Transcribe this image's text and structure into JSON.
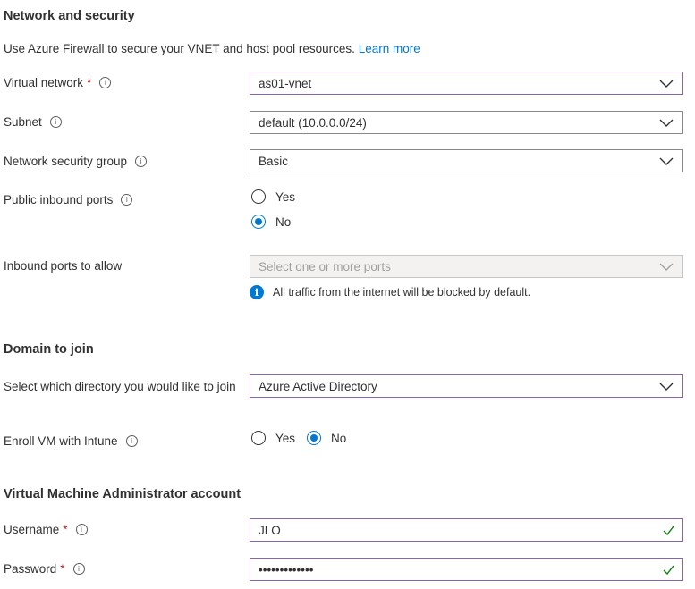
{
  "network": {
    "title": "Network and security",
    "description": "Use Azure Firewall to secure your VNET and host pool resources.",
    "learn_more": "Learn more",
    "virtual_network": {
      "label": "Virtual network",
      "required": "*",
      "value": "as01-vnet"
    },
    "subnet": {
      "label": "Subnet",
      "value": "default (10.0.0.0/24)"
    },
    "nsg": {
      "label": "Network security group",
      "value": "Basic"
    },
    "public_ports": {
      "label": "Public inbound ports",
      "options": [
        "Yes",
        "No"
      ],
      "selected": "No"
    },
    "inbound_ports": {
      "label": "Inbound ports to allow",
      "placeholder": "Select one or more ports"
    },
    "info_message": "All traffic from the internet will be blocked by default."
  },
  "domain": {
    "title": "Domain to join",
    "directory": {
      "label": "Select which directory you would like to join",
      "value": "Azure Active Directory"
    },
    "intune": {
      "label": "Enroll VM with Intune",
      "options": [
        "Yes",
        "No"
      ],
      "selected": "No"
    }
  },
  "admin": {
    "title": "Virtual Machine Administrator account",
    "username": {
      "label": "Username",
      "required": "*",
      "value": "JLO"
    },
    "password": {
      "label": "Password",
      "required": "*",
      "value": "•••••••••••••"
    }
  },
  "icons": {
    "info": "info-icon",
    "chevron": "chevron-down-icon",
    "check": "checkmark-icon",
    "info_filled": "info-filled-icon"
  },
  "colors": {
    "accent": "#0078d4",
    "focus_border": "#8764b8",
    "valid": "#107c10",
    "required": "#a4262c"
  }
}
